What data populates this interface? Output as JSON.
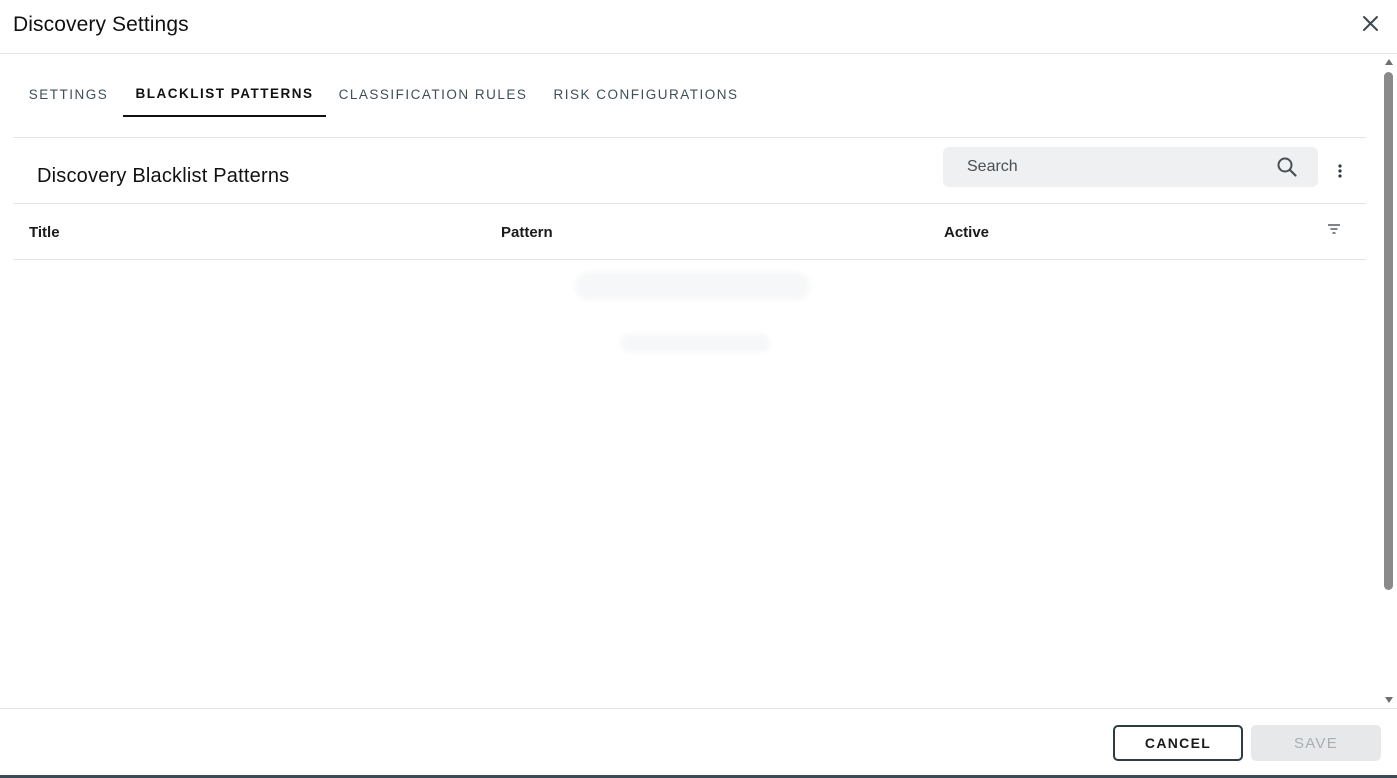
{
  "dialog": {
    "title": "Discovery Settings",
    "close_icon": "close-icon"
  },
  "tabs": [
    {
      "label": "SETTINGS",
      "active": false
    },
    {
      "label": "BLACKLIST PATTERNS",
      "active": true
    },
    {
      "label": "CLASSIFICATION RULES",
      "active": false
    },
    {
      "label": "RISK CONFIGURATIONS",
      "active": false
    }
  ],
  "section": {
    "title": "Discovery Blacklist Patterns",
    "search_placeholder": "Search",
    "search_icon": "search-icon",
    "more_icon": "more-vertical-icon"
  },
  "table": {
    "columns": [
      "Title",
      "Pattern",
      "Active"
    ],
    "filter_icon": "filter-icon",
    "rows": []
  },
  "footer": {
    "cancel_label": "CANCEL",
    "save_label": "SAVE",
    "save_disabled": true
  },
  "colors": {
    "accent": "#111111",
    "tab_inactive": "#3d4f58",
    "search_bg": "#eef0f1",
    "save_disabled_bg": "#e6e8ea"
  }
}
